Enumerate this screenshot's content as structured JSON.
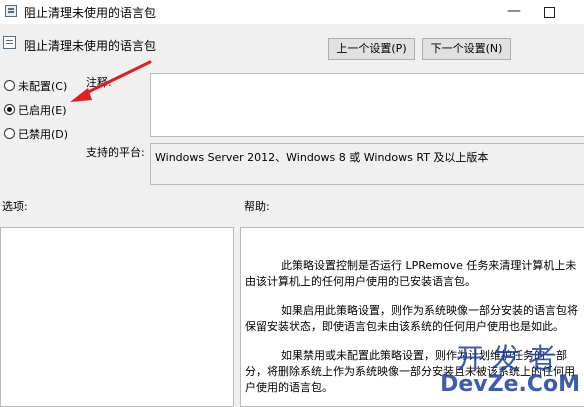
{
  "window": {
    "title": "阻止清理未使用的语言包",
    "min_glyph": "—",
    "max_glyph": ""
  },
  "header": {
    "title": "阻止清理未使用的语言包",
    "prev_button": "上一个设置(P)",
    "next_button": "下一个设置(N)"
  },
  "state": {
    "options": [
      {
        "label": "未配置(C)",
        "selected": false
      },
      {
        "label": "已启用(E)",
        "selected": true
      },
      {
        "label": "已禁用(D)",
        "selected": false
      }
    ]
  },
  "comment": {
    "label": "注释:",
    "value": ""
  },
  "platform": {
    "label": "支持的平台:",
    "value": "Windows Server 2012、Windows 8 或 Windows RT 及以上版本"
  },
  "sections": {
    "options_label": "选项:",
    "help_label": "帮助:"
  },
  "help": {
    "paragraphs": [
      "此策略设置控制是否运行 LPRemove 任务来清理计算机上未由该计算机上的任何用户使用的已安装语言包。",
      "如果启用此策略设置，则作为系统映像一部分安装的语言包将保留安装状态，即使语言包未由该系统的任何用户使用也是如此。",
      "如果禁用或未配置此策略设置，则作为计划维护任务的一部分，将删除系统上作为系统映像一部分安装且未被该系统上的任何用户使用的语言包。"
    ]
  },
  "watermark": {
    "top": "开发者",
    "bottom": "DevZe.CoM"
  },
  "colors": {
    "arrow": "#e02020",
    "watermark": "#1a3fa8"
  }
}
